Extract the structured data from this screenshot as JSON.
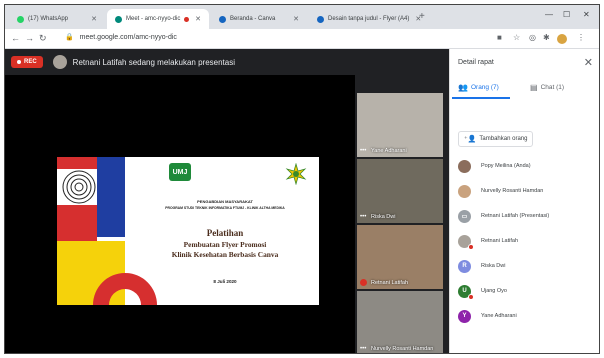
{
  "tabs": [
    {
      "label": "(17) WhatsApp",
      "color": "#25d366"
    },
    {
      "label": "Meet - amc-nyyo-dic",
      "color": "#00897b"
    },
    {
      "label": "Beranda - Canva",
      "color": "#1565c0"
    },
    {
      "label": "Desain tanpa judul - Flyer (A4)",
      "color": "#1565c0"
    }
  ],
  "browser": {
    "url": "meet.google.com/amc-nyyo-dic"
  },
  "meeting": {
    "rec_label": "REC",
    "presenting_text": "Retnani Latifah sedang melakukan presentasi"
  },
  "slide": {
    "logo_text": "UMJ",
    "kicker": "PENGABDIAN MASYARAKAT",
    "program": "PROGRAM STUDI TEKNIK INFORMATIKA FTUMJ - KLINIK ALTHA MEDIKA",
    "title": "Pelatihan",
    "subtitle_line1": "Pembuatan Flyer Promosi",
    "subtitle_line2": "Klinik Kesehatan Berbasis Canva",
    "date": "8 Juli 2020"
  },
  "tiles": [
    {
      "name": "Yane Adharani",
      "bg": "#b7b2aa"
    },
    {
      "name": "Riska Dwi",
      "bg": "#6f6a5e"
    },
    {
      "name": "Retnani Latifah",
      "bg": "#9a7f66"
    },
    {
      "name": "Nurvelly Rosanti Hamdan",
      "bg": "#8d8a84"
    }
  ],
  "panel": {
    "title": "Detail rapat",
    "people_tab": "Orang (7)",
    "chat_tab": "Chat (1)",
    "add_people": "Tambahkan orang",
    "participants": [
      {
        "name": "Popy Meilina (Anda)",
        "initial": "",
        "color": "#8b6d5c",
        "muted": false
      },
      {
        "name": "Nurvelly Rosanti Hamdan",
        "initial": "",
        "color": "#c9a27e",
        "muted": false
      },
      {
        "name": "Retnani Latifah (Presentasi)",
        "initial": "",
        "color": "#9aa0a6",
        "muted": false
      },
      {
        "name": "Retnani Latifah",
        "initial": "",
        "color": "#a8a29a",
        "muted": true
      },
      {
        "name": "Riska Dwi",
        "initial": "R",
        "color": "#7e8ce0",
        "muted": false
      },
      {
        "name": "Ujang Oyo",
        "initial": "U",
        "color": "#2e7d32",
        "muted": true
      },
      {
        "name": "Yane Adharani",
        "initial": "Y",
        "color": "#8e24aa",
        "muted": false
      }
    ]
  }
}
